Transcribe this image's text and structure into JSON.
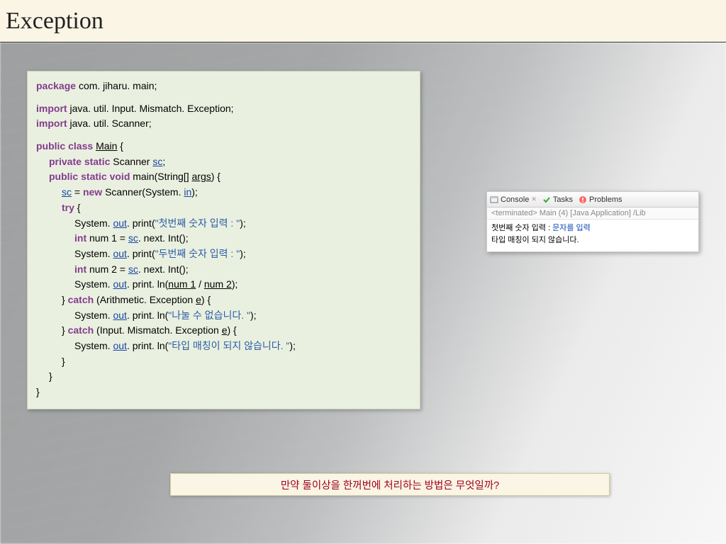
{
  "title": "Exception",
  "code": {
    "package_kw": "package",
    "package_name": "com. jiharu. main;",
    "import_kw": "import",
    "import1": "java. util. Input. Mismatch. Exception;",
    "import2": "java. util. Scanner;",
    "public_kw": "public",
    "class_kw": "class",
    "class_name": "Main",
    "brace_open": " {",
    "private_kw": "private",
    "static_kw": "static",
    "scanner_decl": " Scanner ",
    "sc_var": "sc",
    "semi": ";",
    "void_kw": "void",
    "main_sig": " main(String[] ",
    "args_var": "args",
    "paren_brace": ") {",
    "sc_assign_lhs": "sc",
    "eq": " = ",
    "new_kw": "new",
    "scanner_ctor": " Scanner(System. ",
    "in_var": "in",
    "close_paren_semi": ");",
    "try_kw": "try",
    "brace_open2": " {",
    "sys": "System. ",
    "out": "out",
    "print": ". print(",
    "str1": "\"첫번째 숫자 입력 : \"",
    "end": ");",
    "int_kw": "int",
    "num1_decl": " num 1 = ",
    "sc2": "sc",
    "nextint": ". next. Int();",
    "str2": "\"두번째 숫자 입력 : \"",
    "num2_decl": " num 2 = ",
    "println": ". print. ln(",
    "num1": "num 1",
    "slash": " / ",
    "num2": "num 2",
    "catch_kw": "catch",
    "brace_close": "}",
    "catch1_open": " (Arithmetic. Exception ",
    "e_var": "e",
    "catch_brace": ") {",
    "str3": "\"나눌 수 없습니다. \"",
    "catch2_open": " (Input. Mismatch. Exception ",
    "str4": "\"타입 매칭이 되지 않습니다. \""
  },
  "console": {
    "tab_console": "Console",
    "tab_tasks": "Tasks",
    "tab_problems": "Problems",
    "header": "<terminated> Main (4) [Java Application] /Lib",
    "line1_a": "첫번째 숫자 입력 : ",
    "line1_b": "문자를 입력",
    "line2": "타입 매칭이 되지 않습니다."
  },
  "question": "만약 둘이상을 한꺼번에 처리하는 방법은 무엇일까?"
}
